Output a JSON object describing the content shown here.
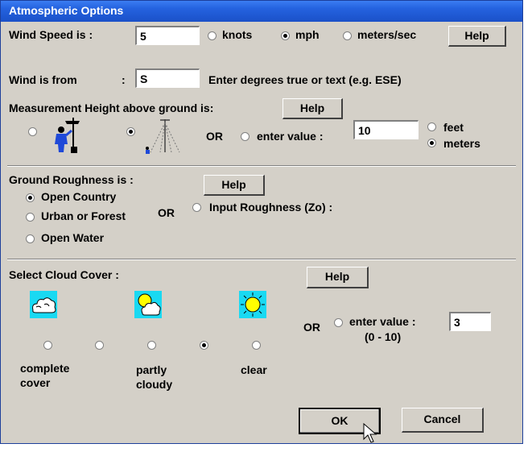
{
  "window": {
    "title": "Atmospheric Options"
  },
  "wind": {
    "speed_label": "Wind Speed is :",
    "speed_value": "5",
    "units": [
      "knots",
      "mph",
      "meters/sec"
    ],
    "selected_unit": "mph",
    "help_label": "Help",
    "from_label": "Wind is from",
    "from_colon": ":",
    "from_value": "S",
    "from_hint": "Enter degrees true or text (e.g. ESE)"
  },
  "measurement": {
    "label": "Measurement Height above ground is:",
    "help_label": "Help",
    "or_label": "OR",
    "enter_value_label": "enter value :",
    "value": "10",
    "units": [
      "feet",
      "meters"
    ],
    "selected_unit": "meters",
    "selected_option": "tower"
  },
  "roughness": {
    "label": "Ground Roughness is :",
    "help_label": "Help",
    "options": [
      "Open Country",
      "Urban or Forest",
      "Open Water"
    ],
    "selected": "Open Country",
    "or_label": "OR",
    "input_label": "Input Roughness (Zo) :"
  },
  "cloud": {
    "label": "Select Cloud Cover :",
    "help_label": "Help",
    "selected_index": 3,
    "captions": {
      "complete_1": "complete",
      "complete_2": "cover",
      "partly_1": "partly",
      "partly_2": "cloudy",
      "clear": "clear"
    },
    "or_label": "OR",
    "enter_value_label": "enter value :",
    "range_label": "(0 - 10)",
    "value": "3"
  },
  "footer": {
    "ok_label": "OK",
    "cancel_label": "Cancel"
  },
  "colors": {
    "titlebar": "#2563e0",
    "dialog": "#d4d0c8",
    "sky": "#19d9f2",
    "sun": "#ffff00"
  }
}
